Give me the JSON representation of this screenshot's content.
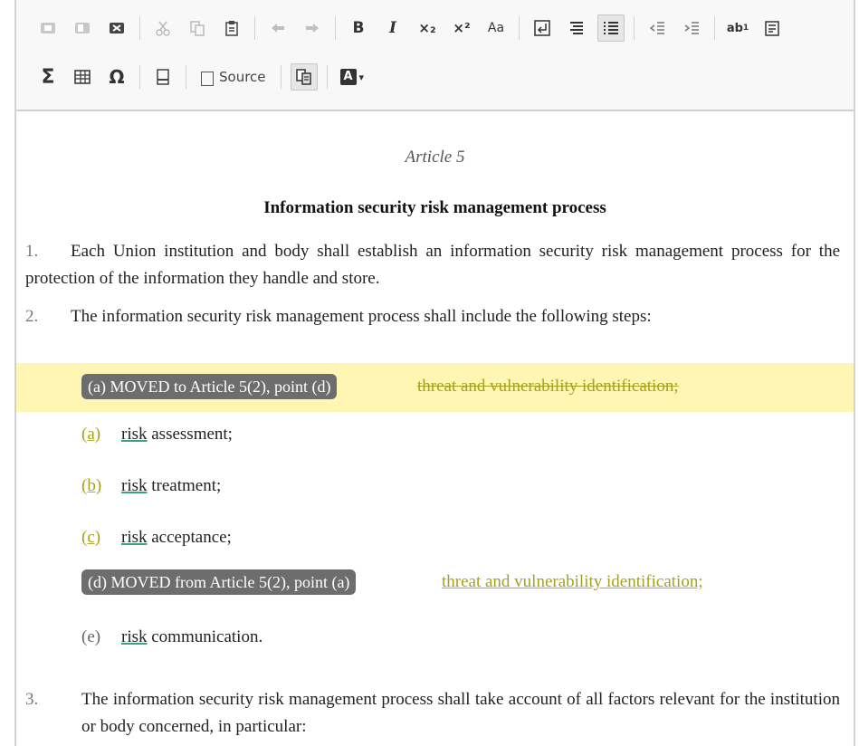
{
  "toolbar": {
    "source_label": "Source",
    "icons_row1": [
      "cut-disabled-icon",
      "copy-disabled-icon",
      "paste-word-icon",
      "scissors-icon",
      "copy-icon",
      "paste-icon",
      "undo-icon",
      "redo-icon",
      "bold-icon",
      "italic-icon",
      "subscript-icon",
      "superscript-icon",
      "change-case-icon",
      "line-break-icon",
      "list-icon",
      "numbered-list-icon",
      "outdent-icon",
      "indent-icon",
      "remove-format-icon",
      "paste-text-icon"
    ],
    "icons_row2": [
      "sum-icon",
      "table-icon",
      "omega-icon",
      "page-break-icon",
      "source-icon",
      "compare-icon",
      "text-color-icon"
    ],
    "glyphs": {
      "bold": "B",
      "italic": "I",
      "subscript": "×₂",
      "superscript": "×²",
      "change_case": "Aa",
      "sum": "Σ",
      "omega": "Ω",
      "text_color": "A",
      "caret": "▾"
    }
  },
  "document": {
    "article_number": "Article 5",
    "article_title": "Information security risk management process",
    "para1": {
      "num": "1.",
      "text": "Each Union institution and body shall establish an information security risk management process for the protection of the information they handle and store."
    },
    "para2": {
      "num": "2.",
      "text": "The information security risk management process shall include the following steps:"
    },
    "moved_a": {
      "badge": "(a) MOVED to Article 5(2), point (d)",
      "text": "threat and vulnerability identification;"
    },
    "items": [
      {
        "label": "(a)",
        "risk": "risk",
        "rest": " assessment;"
      },
      {
        "label": "(b)",
        "risk": "risk",
        "rest": " treatment;"
      },
      {
        "label": "(c)",
        "risk": "risk",
        "rest": " acceptance;"
      }
    ],
    "moved_d": {
      "badge": "(d) MOVED from Article 5(2), point (a)",
      "text": "threat and vulnerability identification;"
    },
    "item_e": {
      "label": "(e)",
      "risk": "risk",
      "rest": " communication."
    },
    "para3": {
      "num": "3.",
      "text": "The information security risk management process shall take account of all factors relevant for the institution or body concerned, in particular:"
    }
  },
  "colors": {
    "highlight_yellow": "#fff6b3",
    "badge_gray": "#6d6d6d",
    "olive_text": "#a6a118",
    "risk_underline": "#3aa57a"
  }
}
